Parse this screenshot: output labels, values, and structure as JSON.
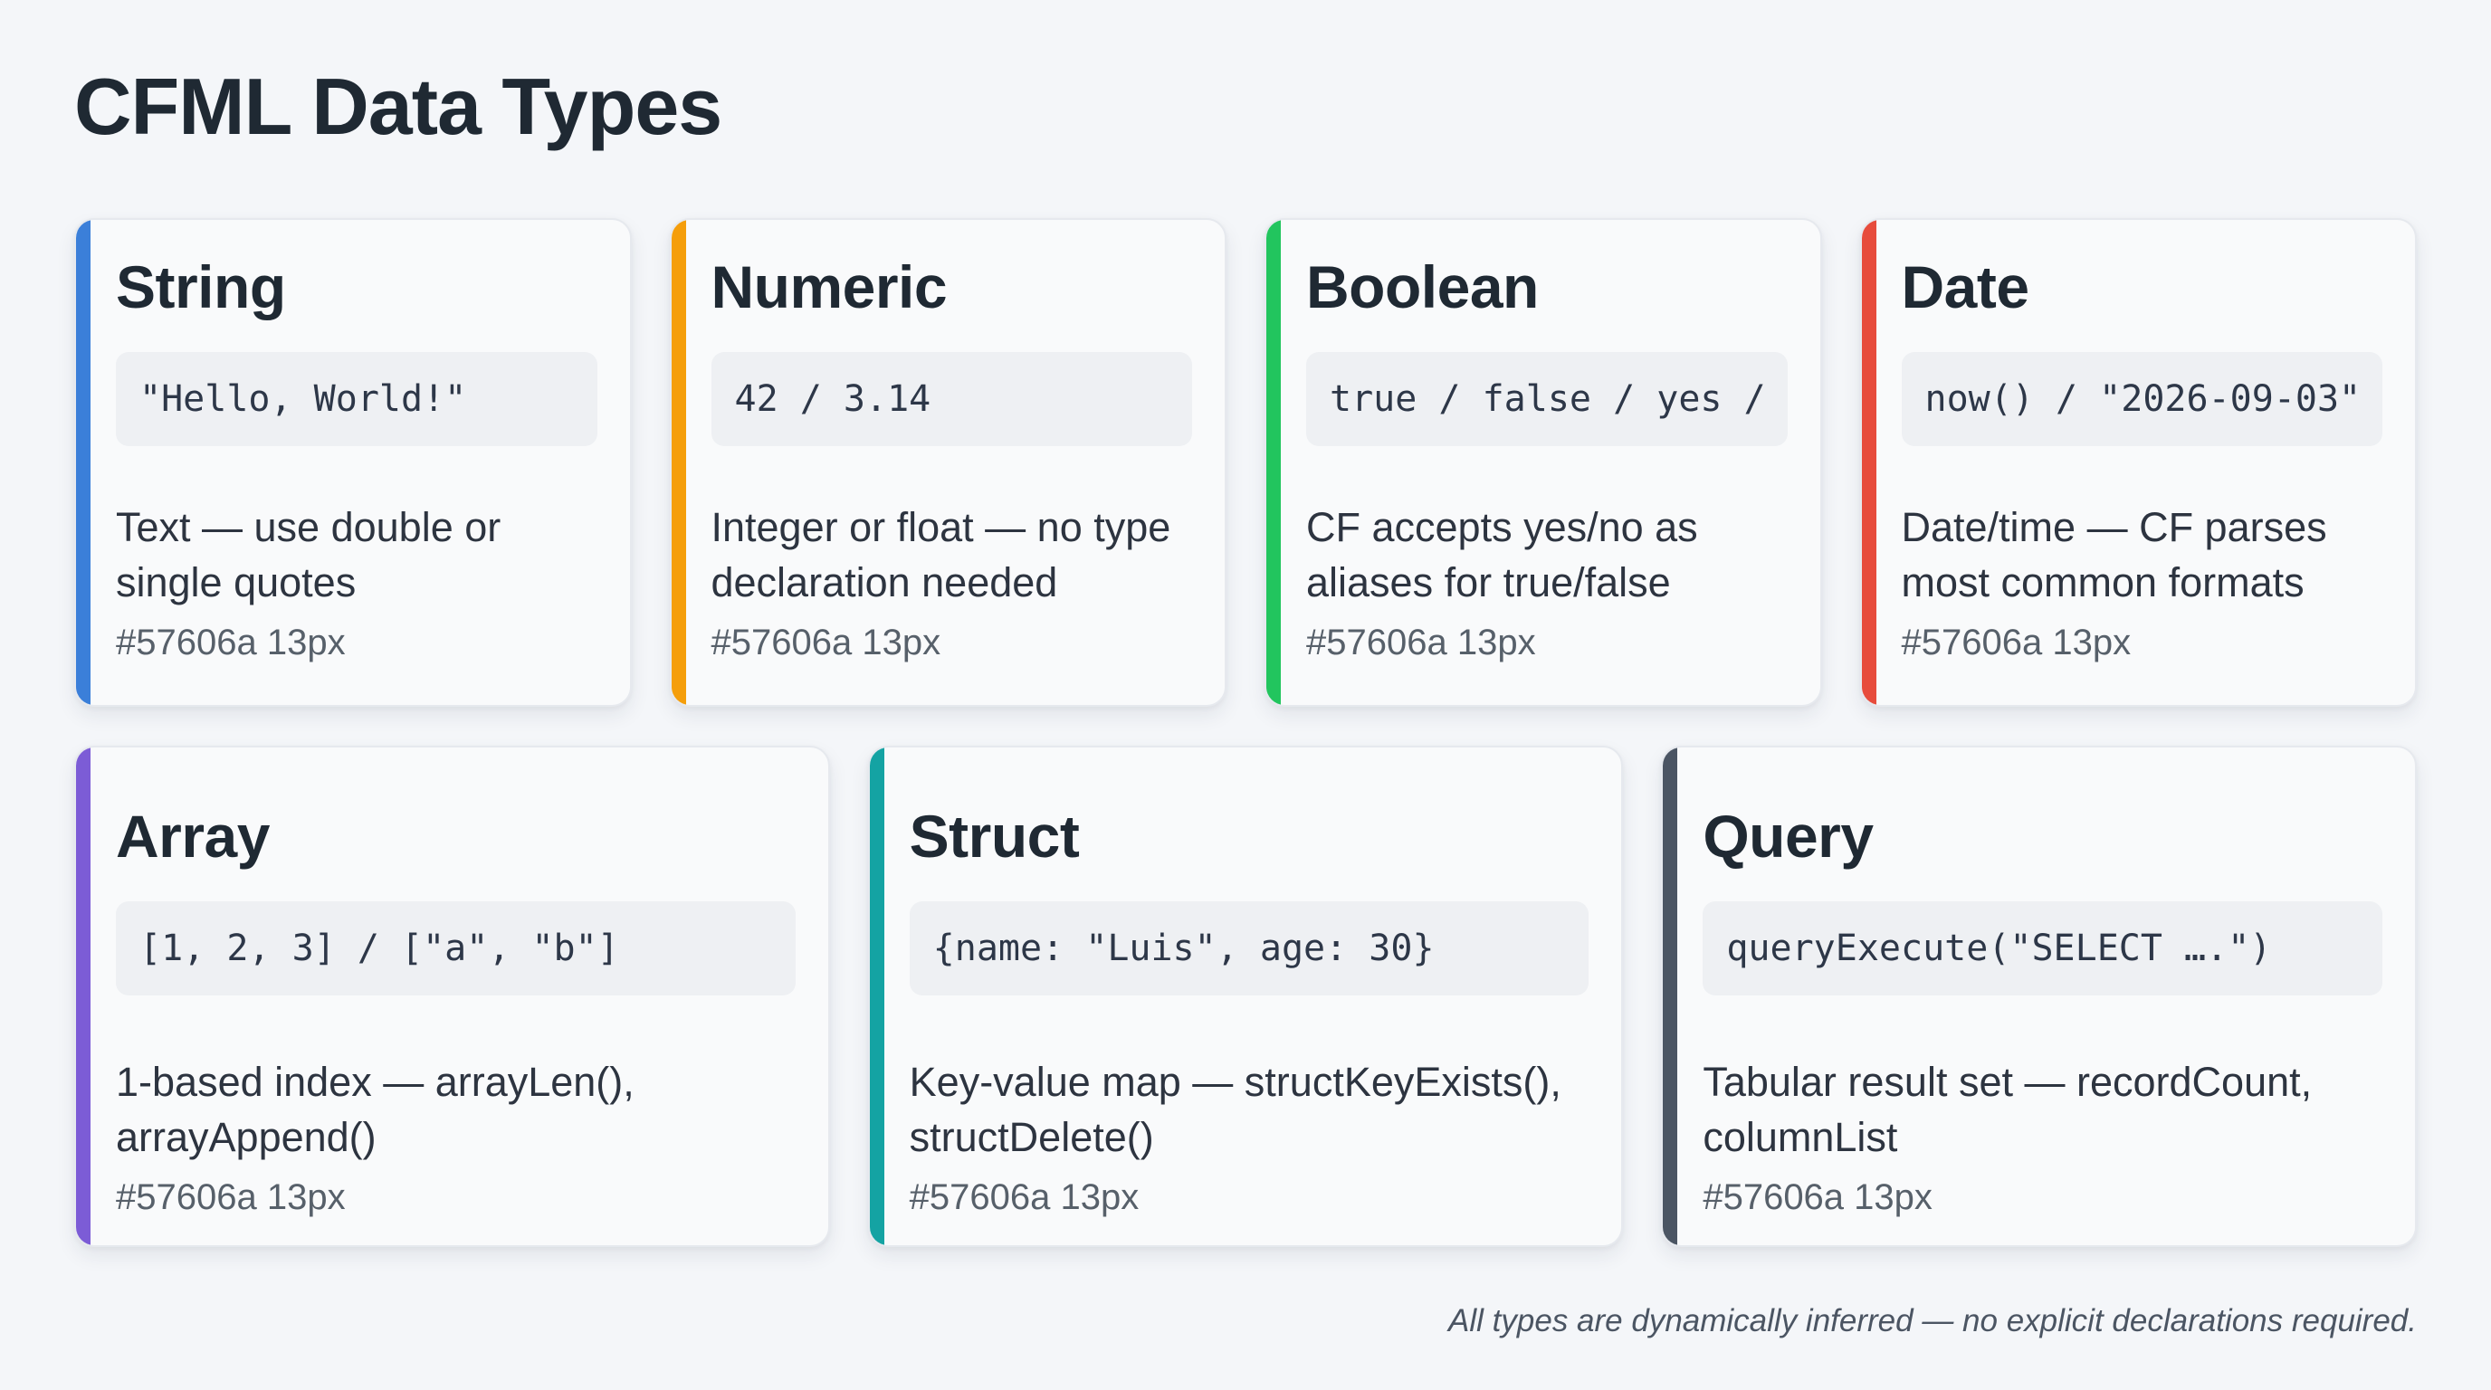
{
  "page": {
    "title": "CFML Data Types",
    "footer": "All types are dynamically inferred — no explicit declarations required."
  },
  "cards": [
    {
      "name": "string",
      "title": "String",
      "code": "\"Hello, World!\"",
      "description": "Text — use double or single quotes",
      "meta": "#57606a 13px",
      "accent": "#3b7fd9"
    },
    {
      "name": "numeric",
      "title": "Numeric",
      "code": "42 / 3.14",
      "description": "Integer or float — no type declaration needed",
      "meta": "#57606a 13px",
      "accent": "#f59e0b"
    },
    {
      "name": "boolean",
      "title": "Boolean",
      "code": "true / false / yes / no",
      "description": "CF accepts yes/no as aliases for true/false",
      "meta": "#57606a 13px",
      "accent": "#22c55e"
    },
    {
      "name": "date",
      "title": "Date",
      "code": "now() / \"2026-09-03\"",
      "description": "Date/time — CF parses most common formats",
      "meta": "#57606a 13px",
      "accent": "#e74c3c"
    },
    {
      "name": "array",
      "title": "Array",
      "code": "[1, 2, 3] / [\"a\", \"b\"]",
      "description": "1-based index — arrayLen(), arrayAppend()",
      "meta": "#57606a 13px",
      "accent": "#7c5cd6"
    },
    {
      "name": "struct",
      "title": "Struct",
      "code": "{name: \"Luis\", age: 30}",
      "description": "Key-value map — structKeyExists(), structDelete()",
      "meta": "#57606a 13px",
      "accent": "#14a3a3"
    },
    {
      "name": "query",
      "title": "Query",
      "code": "queryExecute(\"SELECT ….\")",
      "description": "Tabular result set — recordCount, columnList",
      "meta": "#57606a 13px",
      "accent": "#4b5563"
    }
  ]
}
